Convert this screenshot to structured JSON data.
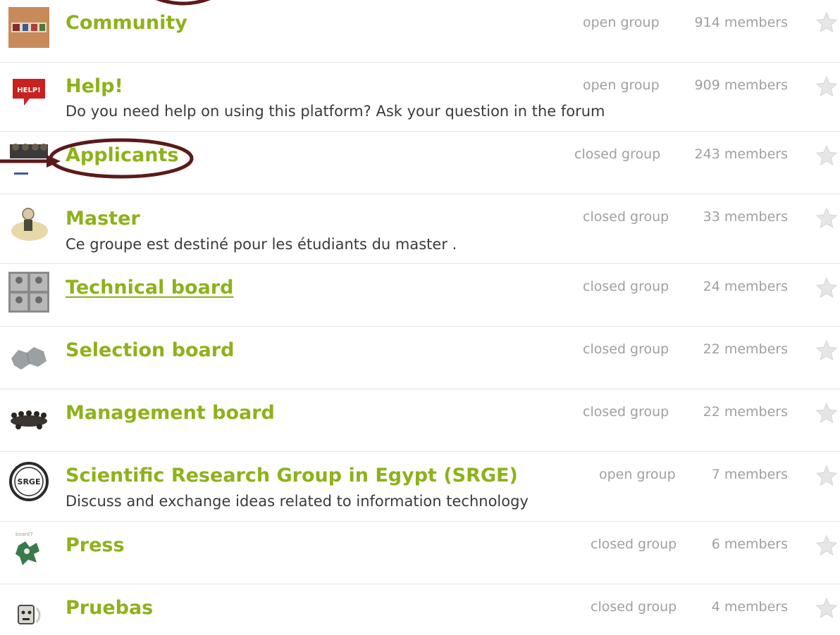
{
  "groups": [
    {
      "name": "Community",
      "description": "",
      "type": "open group",
      "members": "914 members",
      "icon": "community-photo-thumb"
    },
    {
      "name": "Help!",
      "description": "Do you need help on using this platform? Ask your question in the forum",
      "type": "open group",
      "members": "909 members",
      "icon": "help-speech-bubble-thumb"
    },
    {
      "name": "Applicants",
      "description": "",
      "type": "closed group",
      "members": "243 members",
      "icon": "applicants-crowd-thumb"
    },
    {
      "name": "Master",
      "description": "Ce groupe est destiné pour les étudiants du master .",
      "type": "closed group",
      "members": "33 members",
      "icon": "master-graduate-thumb"
    },
    {
      "name": "Technical board",
      "description": "",
      "type": "closed group",
      "members": "24 members",
      "icon": "technical-board-people-thumb"
    },
    {
      "name": "Selection board",
      "description": "",
      "type": "closed group",
      "members": "22 members",
      "icon": "selection-board-map-thumb"
    },
    {
      "name": "Management board",
      "description": "",
      "type": "closed group",
      "members": "22 members",
      "icon": "management-board-table-thumb"
    },
    {
      "name": "Scientific Research Group in Egypt (SRGE)",
      "description": "Discuss and exchange ideas related to information technology",
      "type": "open group",
      "members": "7 members",
      "icon": "srge-logo-thumb",
      "logo_text": "SRGE"
    },
    {
      "name": "Press",
      "description": "",
      "type": "closed group",
      "members": "6 members",
      "icon": "press-figure-thumb",
      "logo_text": "board7"
    },
    {
      "name": "Pruebas",
      "description": "",
      "type": "closed group",
      "members": "4 members",
      "icon": "pruebas-face-thumb"
    }
  ],
  "colors": {
    "group_name": "#8db21a",
    "meta_text": "#a0a0a0",
    "description_text": "#3a3a3a",
    "annotation": "#5c1a1a",
    "star": "#e2e2e2",
    "divider": "#e4e4e4"
  },
  "annotation": {
    "target": "Applicants",
    "style": "red-ellipse-with-arrow"
  }
}
